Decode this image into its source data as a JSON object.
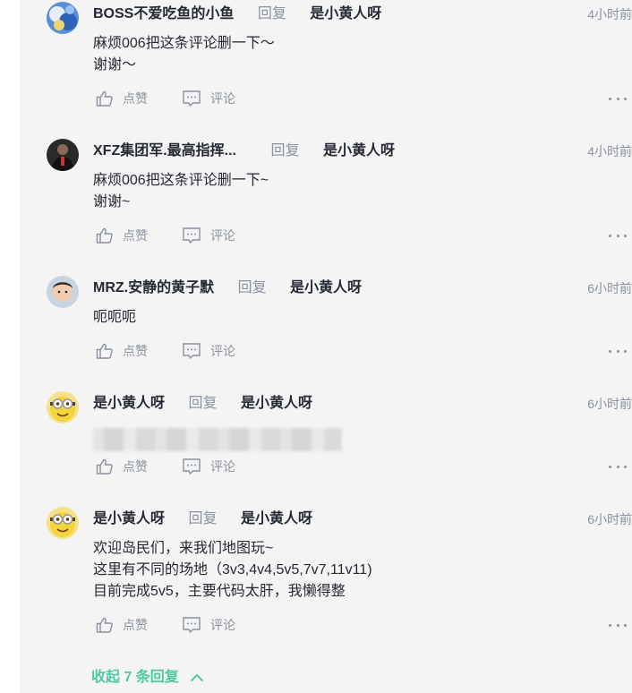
{
  "comments": [
    {
      "user": "BOSS不爱吃鱼的小鱼",
      "reply_word": "回复",
      "target": "是小黄人呀",
      "time": "4小时前",
      "lines": "麻烦006把这条评论删一下～\n谢谢～",
      "like": "点赞",
      "comment": "评论"
    },
    {
      "user": "XFZ集团军.最高指挥...",
      "reply_word": "回复",
      "target": "是小黄人呀",
      "time": "4小时前",
      "lines": "麻烦006把这条评论删一下~\n谢谢~",
      "like": "点赞",
      "comment": "评论"
    },
    {
      "user": "MRZ.安静的黄子默",
      "reply_word": "回复",
      "target": "是小黄人呀",
      "time": "6小时前",
      "lines": "呃呃呃",
      "like": "点赞",
      "comment": "评论"
    },
    {
      "user": "是小黄人呀",
      "reply_word": "回复",
      "target": "是小黄人呀",
      "time": "6小时前",
      "lines": "",
      "like": "点赞",
      "comment": "评论"
    },
    {
      "user": "是小黄人呀",
      "reply_word": "回复",
      "target": "是小黄人呀",
      "time": "6小时前",
      "lines": "欢迎岛民们，来我们地图玩~\n这里有不同的场地（3v3,4v4,5v5,7v7,11v11)\n目前完成5v5，主要代码太肝，我懒得整",
      "like": "点赞",
      "comment": "评论"
    }
  ],
  "collapse_label": "收起 7 条回复",
  "colors": {
    "accent": "#4dc9a4",
    "muted": "#8a919f",
    "panel": "#f4f4f4"
  },
  "icons": [
    "thumbs-up-icon",
    "comment-icon",
    "more-icon",
    "chevron-up-icon"
  ]
}
